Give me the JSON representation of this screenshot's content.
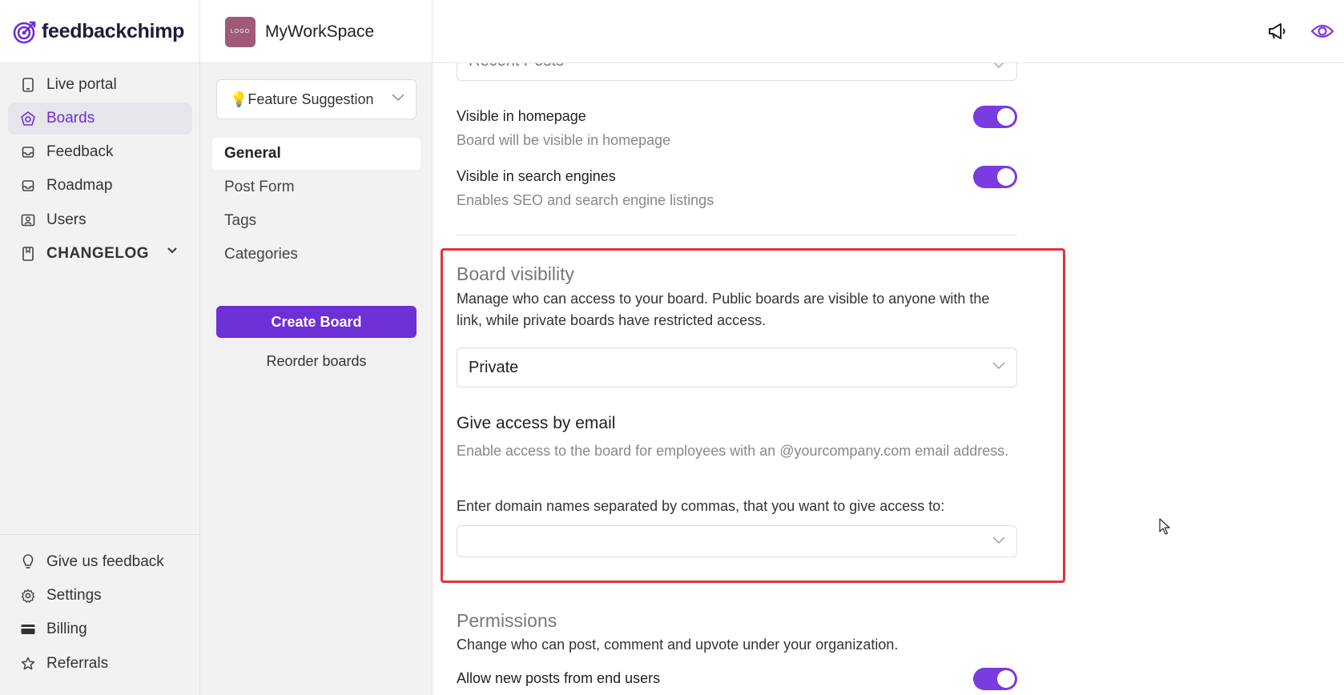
{
  "brand": {
    "name": "feedbackchimp",
    "icon": "target-icon",
    "accent": "#6d2fd6"
  },
  "workspace": {
    "name": "MyWorkSpace",
    "logo_text": "LOGO"
  },
  "topbar": {
    "icons": [
      "megaphone-icon",
      "eye-icon"
    ]
  },
  "nav": {
    "items": [
      {
        "label": "Live portal",
        "icon": "tablet-icon"
      },
      {
        "label": "Boards",
        "icon": "board-icon",
        "active": true
      },
      {
        "label": "Feedback",
        "icon": "inbox-icon"
      },
      {
        "label": "Roadmap",
        "icon": "inbox-icon"
      },
      {
        "label": "Users",
        "icon": "users-icon"
      },
      {
        "label": "CHANGELOG",
        "icon": "book-icon"
      }
    ],
    "bottom": [
      {
        "label": "Give us feedback",
        "icon": "lightbulb-icon"
      },
      {
        "label": "Settings",
        "icon": "gear-icon"
      },
      {
        "label": "Billing",
        "icon": "card-icon"
      },
      {
        "label": "Referrals",
        "icon": "star-icon"
      }
    ]
  },
  "subnav": {
    "board_select": "💡Feature Suggestion",
    "items": [
      "General",
      "Post Form",
      "Tags",
      "Categories"
    ],
    "active": "General",
    "create_label": "Create Board",
    "reorder_label": "Reorder boards"
  },
  "main": {
    "top_dropdown_value": "Recent Posts",
    "visible_homepage": {
      "title": "Visible in homepage",
      "desc": "Board will be visible in homepage",
      "on": true
    },
    "visible_search": {
      "title": "Visible in search engines",
      "desc": "Enables SEO and search engine listings",
      "on": true
    },
    "board_visibility": {
      "title": "Board visibility",
      "desc": "Manage who can access to your board. Public boards are visible to anyone with the link, while private boards have restricted access.",
      "selected": "Private"
    },
    "email_access": {
      "title": "Give access by email",
      "desc": "Enable access to the board for employees with an @yourcompany.com email address.",
      "domains_label": "Enter domain names separated by commas, that you want to give access to:",
      "domains_value": ""
    },
    "permissions": {
      "title": "Permissions",
      "desc": "Change who can post, comment and upvote under your organization.",
      "allow_posts": {
        "title": "Allow new posts from end users",
        "on": true
      }
    }
  }
}
